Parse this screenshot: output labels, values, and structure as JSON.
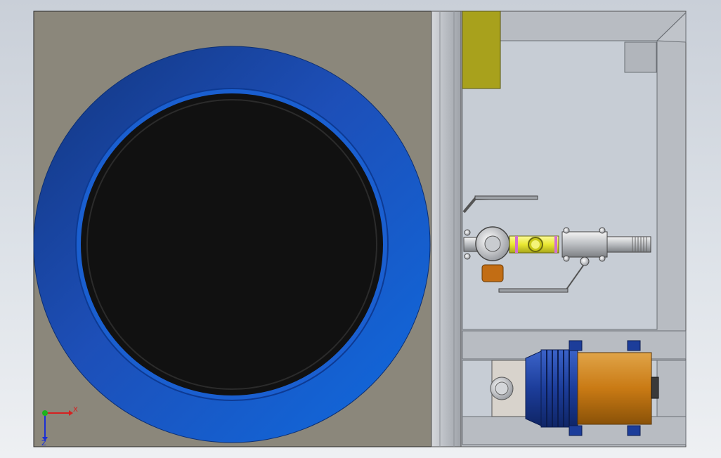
{
  "viewport": {
    "background_top": "#c9cfd8",
    "background_bottom": "#eef0f3"
  },
  "colors": {
    "base_plate": "#8b877b",
    "tank_ring": "#1a5fd0",
    "tank_ring_dark": "#12357e",
    "tank_opening": "#111111",
    "frame_steel": "#b8bcc2",
    "compartment": "#c7cdd5",
    "yellow_block": "#a8a11c",
    "valve_yellow": "#eae832",
    "pump_orange": "#c97a14",
    "pump_blue": "#1c3d9a"
  },
  "triad": {
    "x_label": "X",
    "z_label": "Z",
    "x_icon": "x-axis-arrow-icon",
    "y_icon": "y-axis-arrow-icon",
    "z_icon": "z-axis-arrow-icon"
  }
}
